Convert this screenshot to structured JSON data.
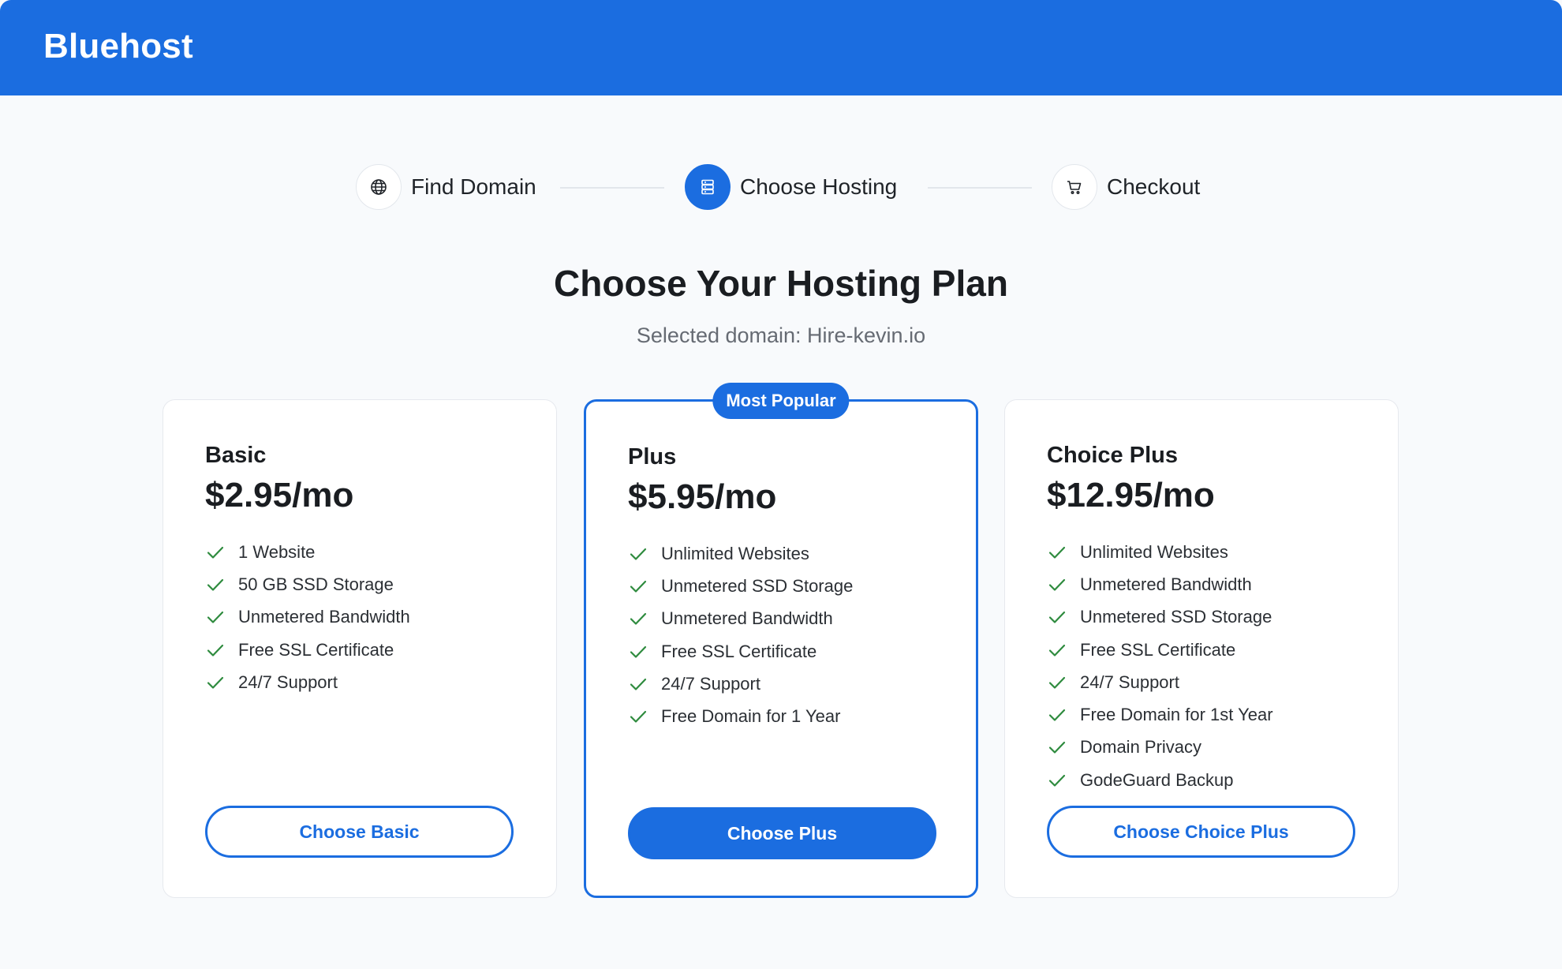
{
  "header": {
    "brand": "Bluehost",
    "accent": "#1b6de0"
  },
  "steps": [
    {
      "label": "Find Domain",
      "icon": "globe-icon",
      "active": false
    },
    {
      "label": "Choose Hosting",
      "icon": "server-icon",
      "active": true
    },
    {
      "label": "Checkout",
      "icon": "cart-icon",
      "active": false
    }
  ],
  "page": {
    "title": "Choose Your Hosting Plan",
    "subtitle": "Selected domain: Hire-kevin.io"
  },
  "plans": [
    {
      "name": "Basic",
      "price": "$2.95/mo",
      "features": [
        "1 Website",
        "50 GB SSD Storage",
        "Unmetered Bandwidth",
        "Free SSL Certificate",
        "24/7 Support"
      ],
      "button": "Choose Basic",
      "featured": false
    },
    {
      "name": "Plus",
      "price": "$5.95/mo",
      "badge": "Most Popular",
      "features": [
        "Unlimited Websites",
        "Unmetered SSD Storage",
        "Unmetered Bandwidth",
        "Free SSL Certificate",
        "24/7 Support",
        "Free Domain for 1 Year"
      ],
      "button": "Choose Plus",
      "featured": true
    },
    {
      "name": "Choice Plus",
      "price": "$12.95/mo",
      "features": [
        "Unlimited Websites",
        "Unmetered Bandwidth",
        "Unmetered SSD Storage",
        "Free SSL Certificate",
        "24/7 Support",
        "Free Domain for 1st Year",
        "Domain Privacy",
        "GodeGuard Backup"
      ],
      "button": "Choose Choice Plus",
      "featured": false
    }
  ],
  "colors": {
    "check": "#2e8b3e",
    "text": "#1a1d21",
    "muted": "#666b73"
  }
}
